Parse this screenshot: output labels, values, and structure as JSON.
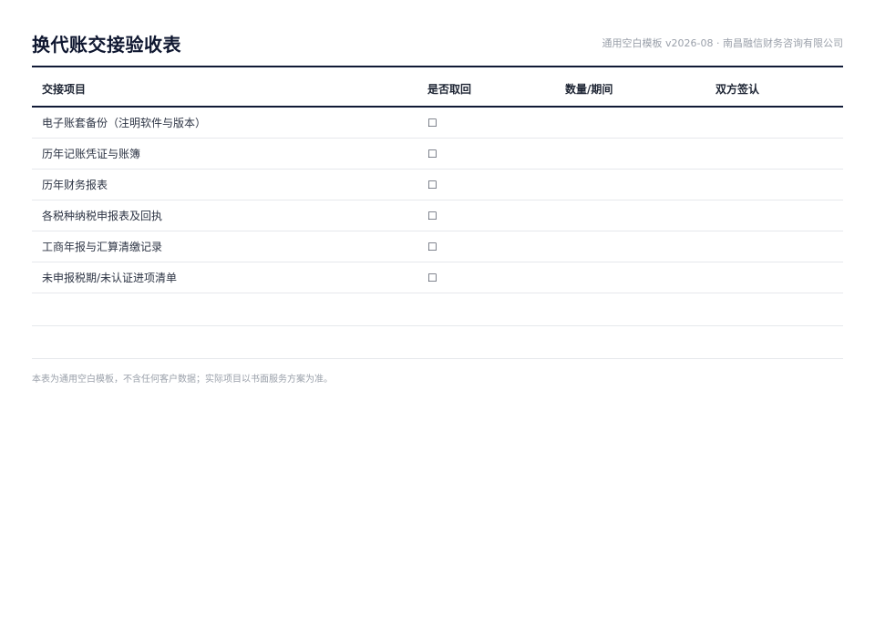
{
  "document": {
    "title": "换代账交接验收表",
    "meta": "通用空白模板 v2026-08 · 南昌融信财务咨询有限公司"
  },
  "table": {
    "headers": [
      "交接项目",
      "是否取回",
      "数量/期间",
      "双方签认"
    ],
    "rows": [
      {
        "item": "电子账套备份（注明软件与版本）",
        "retrieved": "☐",
        "quantity": "",
        "signoff": ""
      },
      {
        "item": "历年记账凭证与账簿",
        "retrieved": "☐",
        "quantity": "",
        "signoff": ""
      },
      {
        "item": "历年财务报表",
        "retrieved": "☐",
        "quantity": "",
        "signoff": ""
      },
      {
        "item": "各税种纳税申报表及回执",
        "retrieved": "☐",
        "quantity": "",
        "signoff": ""
      },
      {
        "item": "工商年报与汇算清缴记录",
        "retrieved": "☐",
        "quantity": "",
        "signoff": ""
      },
      {
        "item": "未申报税期/未认证进项清单",
        "retrieved": "☐",
        "quantity": "",
        "signoff": ""
      },
      {
        "item": "",
        "retrieved": "",
        "quantity": "",
        "signoff": ""
      },
      {
        "item": "",
        "retrieved": "",
        "quantity": "",
        "signoff": ""
      }
    ]
  },
  "footer": {
    "note": "本表为通用空白模板，不含任何客户数据；实际项目以书面服务方案为准。"
  }
}
